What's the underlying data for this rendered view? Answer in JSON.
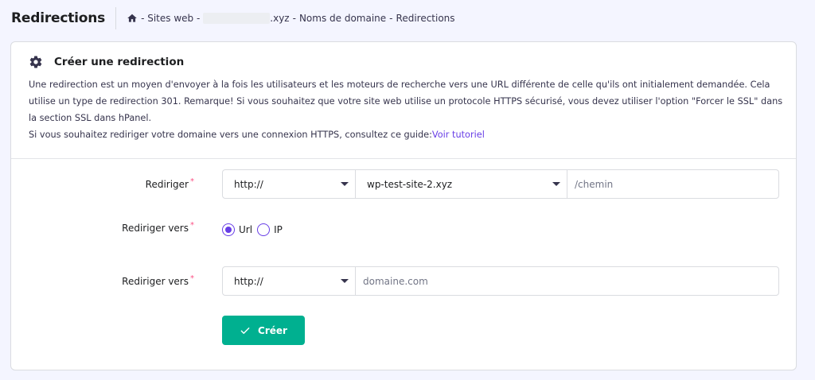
{
  "header": {
    "title": "Redirections",
    "breadcrumb": {
      "sites_web": "- Sites web -",
      "domain_suffix": ".xyz",
      "sep1": "-",
      "noms_domaine": "Noms de domaine",
      "sep2": "-",
      "redirections": "Redirections"
    }
  },
  "card": {
    "title": "Créer une redirection",
    "description_line1": "Une redirection est un moyen d'envoyer à la fois les utilisateurs et les moteurs de recherche vers une URL différente de celle qu'ils ont initialement demandée. Cela utilise un type de redirection 301. Remarque! Si vous souhaitez que votre site web utilise un protocole HTTPS sécurisé, vous devez utiliser l'option \"Forcer le SSL\" dans la section SSL dans hPanel.",
    "description_line2": "Si vous souhaitez rediriger votre domaine vers une connexion HTTPS, consultez ce guide:",
    "tutorial_link": "Voir tutoriel"
  },
  "form": {
    "redirect_label": "Rediriger",
    "redirect_protocol": "http://",
    "redirect_domain": "wp-test-site-2.xyz",
    "path_placeholder": "/chemin",
    "redirect_type_label": "Rediriger vers",
    "radio_url": "Url",
    "radio_ip": "IP",
    "target_label": "Rediriger vers",
    "target_protocol": "http://",
    "target_placeholder": "domaine.com",
    "required_mark": "*",
    "create_button": "Créer"
  },
  "colors": {
    "accent": "#673de6",
    "button": "#00b090",
    "required": "#fc5185"
  }
}
